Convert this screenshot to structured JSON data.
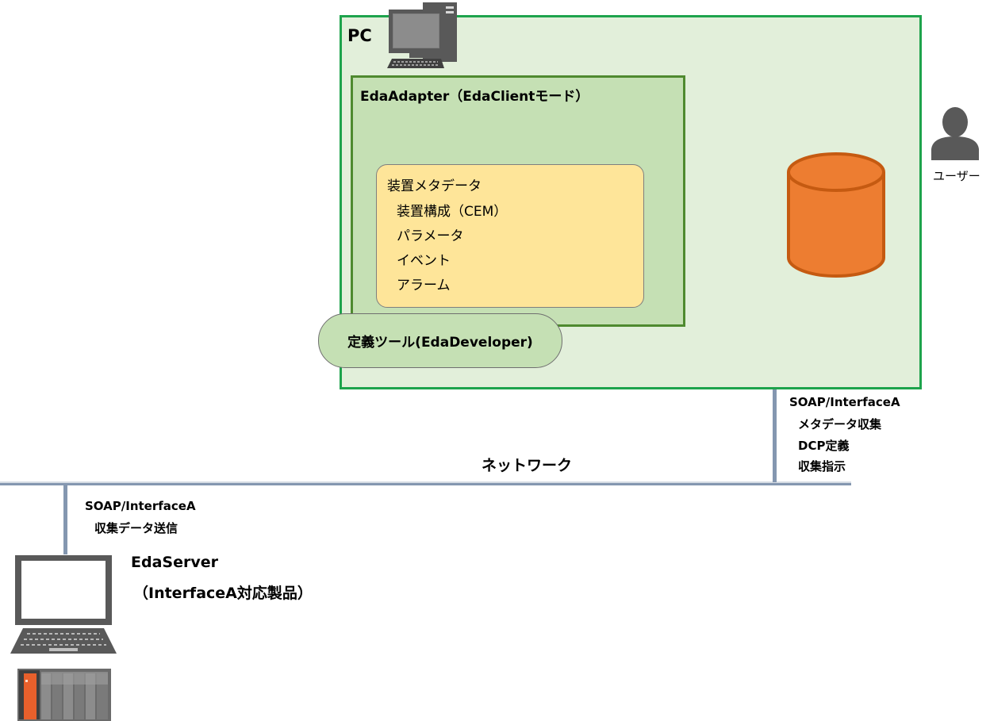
{
  "pc": {
    "title": "PC"
  },
  "eda_adapter": {
    "title": "EdaAdapter（EdaClientモード）"
  },
  "metadata": {
    "heading": "装置メタデータ",
    "items": [
      "装置構成（CEM）",
      "パラメータ",
      "イベント",
      "アラーム"
    ]
  },
  "tool": {
    "label": "定義ツール(EdaDeveloper)"
  },
  "user": {
    "label": "ユーザー"
  },
  "pc_link": {
    "protocol": "SOAP/InterfaceA",
    "items": [
      "メタデータ収集",
      "DCP定義",
      "収集指示"
    ]
  },
  "network": {
    "label": "ネットワーク"
  },
  "server_link": {
    "protocol": "SOAP/InterfaceA",
    "items": [
      "収集データ送信"
    ]
  },
  "server": {
    "title": "EdaServer",
    "subtitle": "（InterfaceA対応製品）"
  },
  "colors": {
    "pc_fill": "#e2efda",
    "pc_border": "#1ea34c",
    "adapter_fill": "#c5e0b4",
    "adapter_border": "#4f8a2f",
    "metadata_fill": "#fee599",
    "database": "#ed7d31",
    "network_line": "#8497b0"
  },
  "icons": [
    "desktop-pc-icon",
    "database-icon",
    "user-icon",
    "laptop-icon",
    "plc-device-icon"
  ]
}
